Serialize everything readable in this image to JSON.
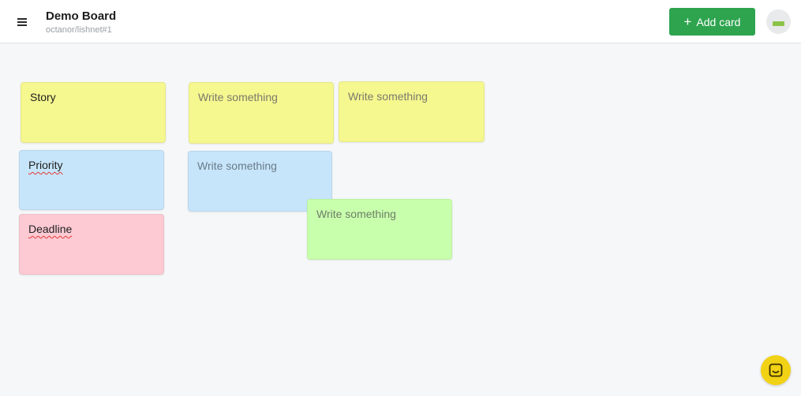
{
  "header": {
    "title": "Demo Board",
    "path": "octanor/lishnet#1",
    "add_card_label": "Add card",
    "menu_icon": "hamburger-menu-icon",
    "plus_icon": "plus-icon"
  },
  "colors": {
    "accent_green": "#2ea44f",
    "card_yellow": "#f5f78f",
    "card_blue": "#c6e5fa",
    "card_pink": "#fdcad4",
    "card_green": "#c8ffad",
    "chat_yellow": "#f2d214"
  },
  "cards": [
    {
      "text": "Story",
      "color": "yellow",
      "placeholder": false
    },
    {
      "text": "Priority",
      "color": "blue",
      "placeholder": false
    },
    {
      "text": "Deadline",
      "color": "pink",
      "placeholder": false
    },
    {
      "text": "Write something",
      "color": "yellow",
      "placeholder": true
    },
    {
      "text": "Write something",
      "color": "yellow",
      "placeholder": true
    },
    {
      "text": "Write something",
      "color": "blue",
      "placeholder": true
    },
    {
      "text": "Write something",
      "color": "green",
      "placeholder": true
    }
  ],
  "chat": {
    "icon": "chat-icon"
  }
}
